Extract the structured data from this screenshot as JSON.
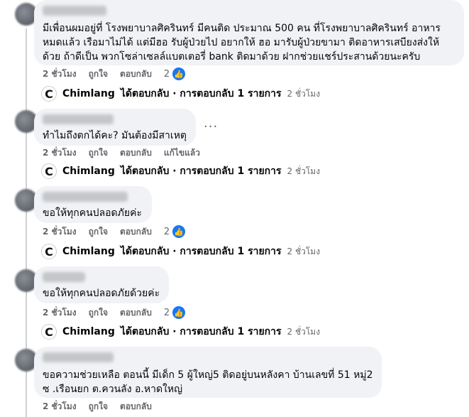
{
  "comments": [
    {
      "text": "มีเพื่อนผมอยู่ที่ โรงพยาบาลศิครินทร์ มีคนติด ประมาณ 500 คน ที่โรงพยาบาลศิครินทร์ อาหารหมดแล้ว เรือมาไม่ได้ แต่มีฮอ รับผู้ป่วยไป อยากให้ ฮอ มารับผู้ป่วยขามา ติดอาหารเสบียงส่งให้ด้วย ถ้าดีเป็น พวกโซล่าเซลล์แบตเตอรี่ bank ติดมาด้วย ฝากช่วยแชร์ประสานด้วยนะครับ",
      "time": "2 ชั่วโมง",
      "like": "ถูกใจ",
      "reply": "ตอบกลับ",
      "extra": "",
      "reactions": "2"
    },
    {
      "text": "ทำไมถึงตกได้คะ? มันต้องมีสาเหตุ",
      "time": "2 ชั่วโมง",
      "like": "ถูกใจ",
      "reply": "ตอบกลับ",
      "extra": "แก้ไขแล้ว",
      "reactions": ""
    },
    {
      "text": "ขอให้ทุกคนปลอดภัยค่ะ",
      "time": "2 ชั่วโมง",
      "like": "ถูกใจ",
      "reply": "ตอบกลับ",
      "extra": "",
      "reactions": "2"
    },
    {
      "text": "ขอให้ทุกคนปลอดภัยด้วยค่ะ",
      "time": "2 ชั่วโมง",
      "like": "ถูกใจ",
      "reply": "ตอบกลับ",
      "extra": "",
      "reactions": "2"
    },
    {
      "text": "ขอความช่วยเหลือ ตอนนี้ มีเด็ก 5 ผู้ใหญ่5 ติดอยู่บนหลังคา บ้านเลขที่ 51 หมู่2 ซ .เรือนยก ต.ควนลัง อ.หาดใหญ่",
      "time": "2 ชั่วโมง",
      "like": "ถูกใจ",
      "reply": "ตอบกลับ",
      "extra": "",
      "reactions": ""
    }
  ],
  "page_reply": {
    "name": "Chimlang",
    "text": "ได้ตอบกลับ · การตอบกลับ 1 รายการ",
    "time": "2 ชั่วโมง",
    "logo": "C"
  },
  "more_label": "···",
  "colors": {
    "like_blue": "#1877f2",
    "bubble": "#f0f2f5",
    "meta": "#65676b"
  }
}
